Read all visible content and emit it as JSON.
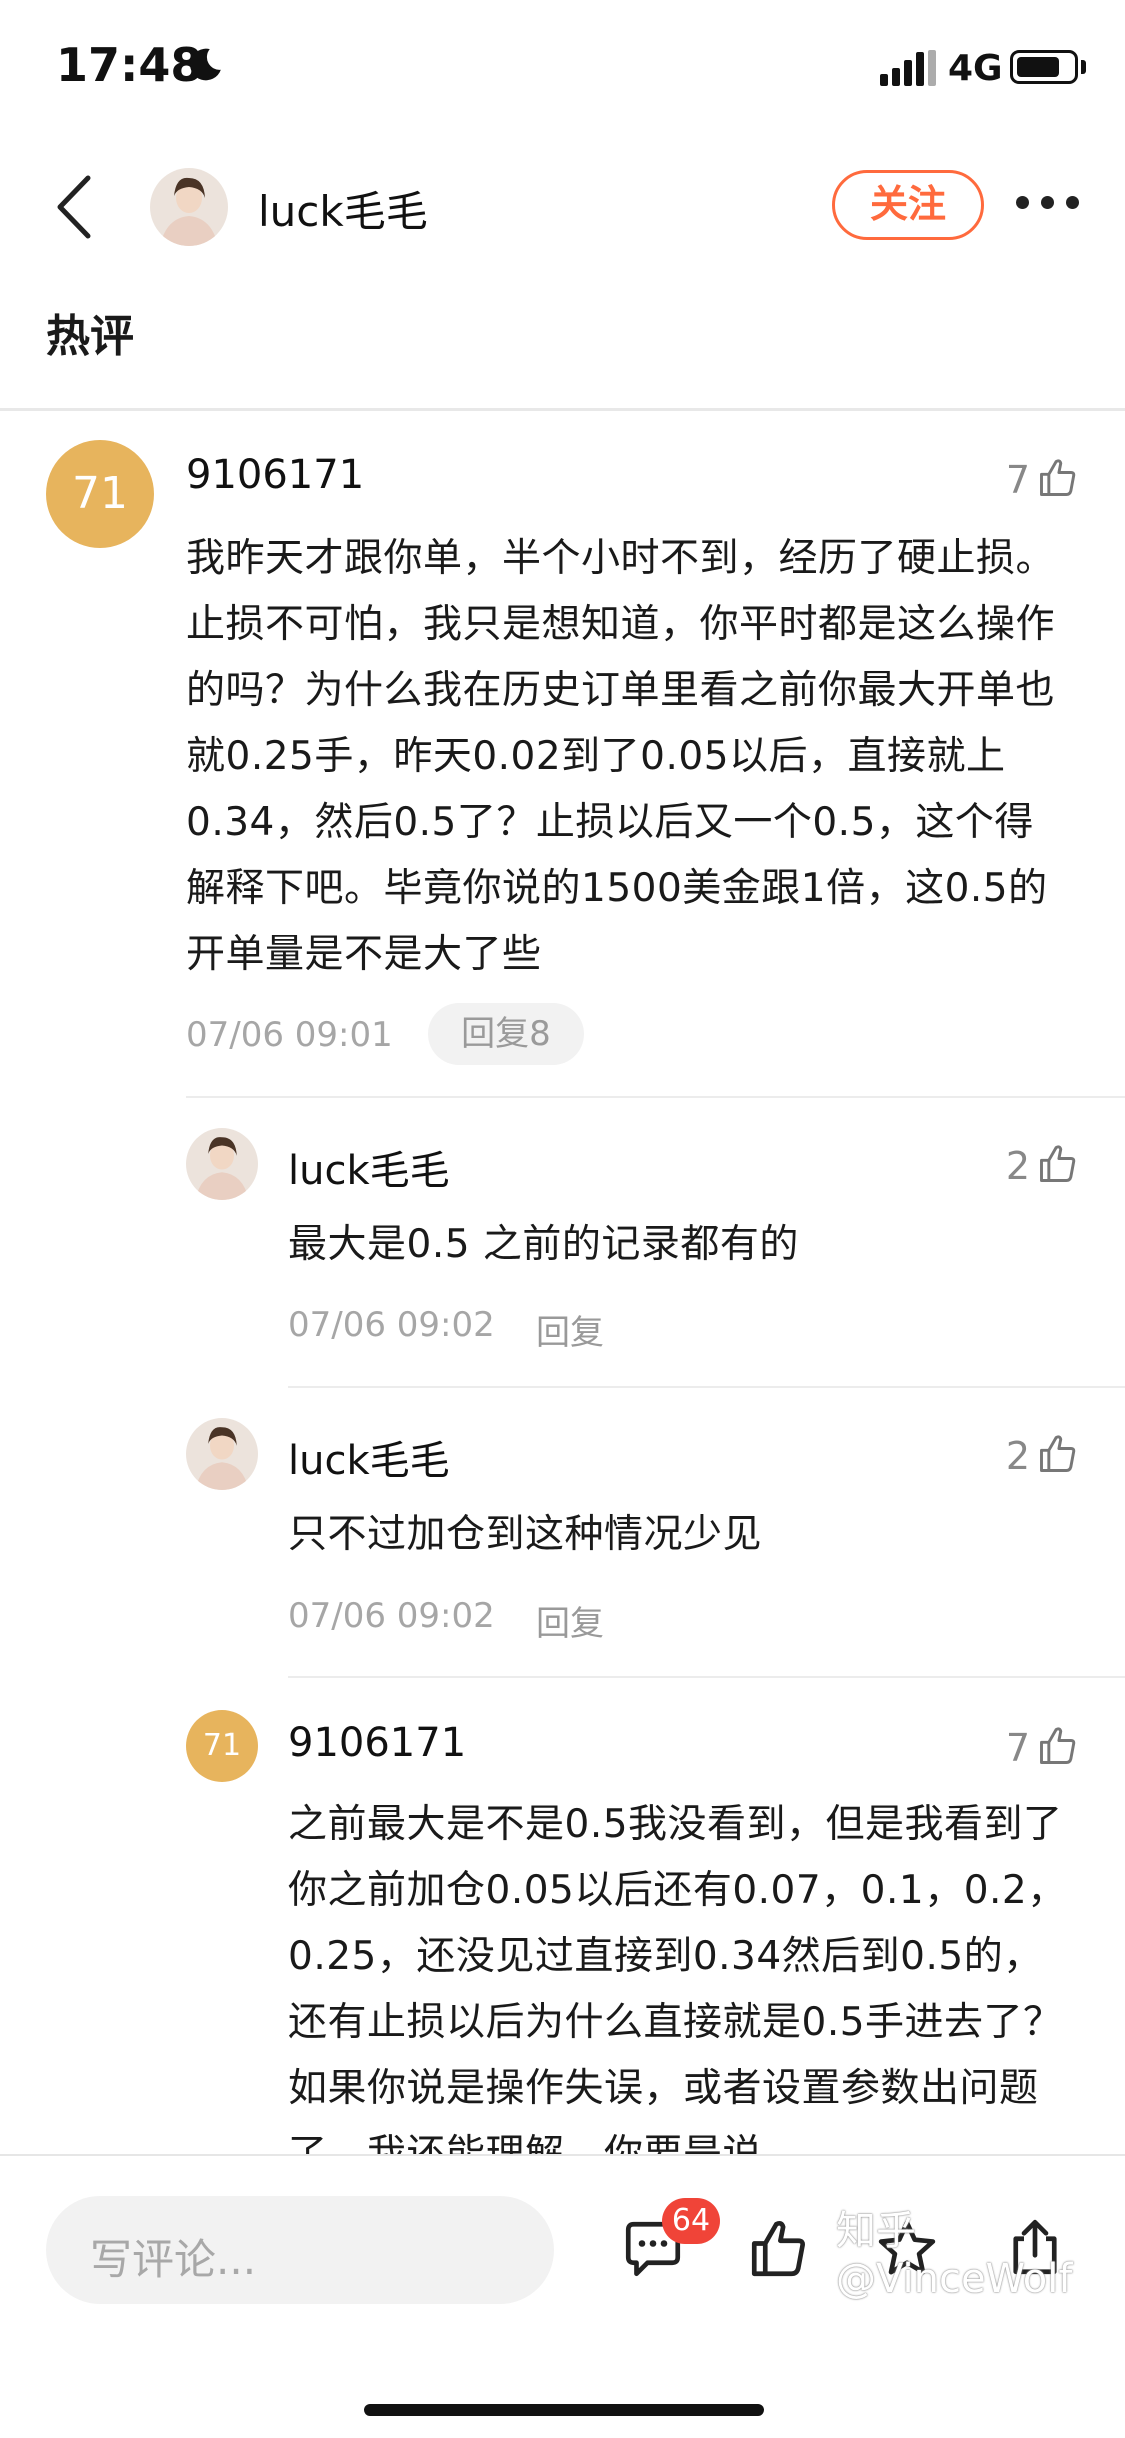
{
  "status_bar": {
    "time": "17:48",
    "network": "4G",
    "battery_level": 0.75,
    "icons": [
      "moon-icon",
      "signal-icon",
      "battery-icon"
    ]
  },
  "header": {
    "username": "luck毛毛",
    "follow_label": "关注",
    "icons": [
      "back-icon",
      "more-icon"
    ]
  },
  "section_title": "热评",
  "comments": [
    {
      "avatar_text": "71",
      "username": "9106171",
      "likes": "7",
      "text": "我昨天才跟你单，半个小时不到，经历了硬止损。止损不可怕，我只是想知道，你平时都是这么操作的吗？为什么我在历史订单里看之前你最大开单也就0.25手，昨天0.02到了0.05以后，直接就上0.34，然后0.5了？止损以后又一个0.5，这个得解释下吧。毕竟你说的1500美金跟1倍，这0.5的开单量是不是大了些",
      "time": "07/06 09:01",
      "reply_label": "回复8"
    }
  ],
  "replies": [
    {
      "username": "luck毛毛",
      "likes": "2",
      "text": "最大是0.5 之前的记录都有的",
      "time": "07/06 09:02",
      "reply_label": "回复"
    },
    {
      "username": "luck毛毛",
      "likes": "2",
      "text": "只不过加仓到这种情况少见",
      "time": "07/06 09:02",
      "reply_label": "回复"
    },
    {
      "avatar_text": "71",
      "username": "9106171",
      "likes": "7",
      "text": "之前最大是不是0.5我没看到，但是我看到了你之前加仓0.05以后还有0.07，0.1，0.2，0.25，还没见过直接到0.34然后到0.5的，还有止损以后为什么直接就是0.5手进去了？如果你说是操作失误，或者设置参数出问题了，我还能理解，你要是说"
    }
  ],
  "bottom_bar": {
    "input_placeholder": "写评论...",
    "comment_count": "64",
    "icons": [
      "comment-icon",
      "like-icon",
      "star-icon",
      "share-icon"
    ]
  },
  "watermark": "知乎 @VinceWolf",
  "colors": {
    "accent": "#ff6a3d",
    "number_avatar": "#e7b45d",
    "badge": "#f04438"
  }
}
